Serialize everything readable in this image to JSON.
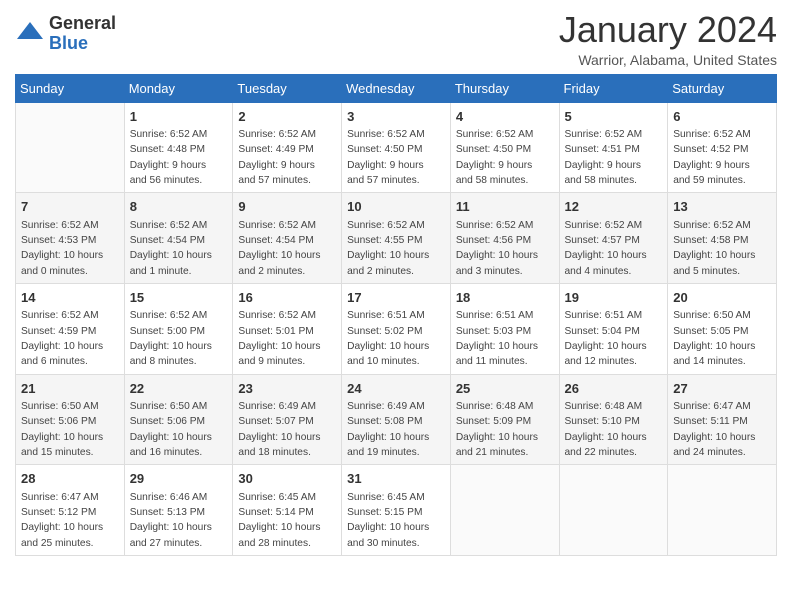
{
  "logo": {
    "general": "General",
    "blue": "Blue"
  },
  "title": "January 2024",
  "location": "Warrior, Alabama, United States",
  "days_of_week": [
    "Sunday",
    "Monday",
    "Tuesday",
    "Wednesday",
    "Thursday",
    "Friday",
    "Saturday"
  ],
  "weeks": [
    [
      {
        "day": "",
        "info": ""
      },
      {
        "day": "1",
        "info": "Sunrise: 6:52 AM\nSunset: 4:48 PM\nDaylight: 9 hours\nand 56 minutes."
      },
      {
        "day": "2",
        "info": "Sunrise: 6:52 AM\nSunset: 4:49 PM\nDaylight: 9 hours\nand 57 minutes."
      },
      {
        "day": "3",
        "info": "Sunrise: 6:52 AM\nSunset: 4:50 PM\nDaylight: 9 hours\nand 57 minutes."
      },
      {
        "day": "4",
        "info": "Sunrise: 6:52 AM\nSunset: 4:50 PM\nDaylight: 9 hours\nand 58 minutes."
      },
      {
        "day": "5",
        "info": "Sunrise: 6:52 AM\nSunset: 4:51 PM\nDaylight: 9 hours\nand 58 minutes."
      },
      {
        "day": "6",
        "info": "Sunrise: 6:52 AM\nSunset: 4:52 PM\nDaylight: 9 hours\nand 59 minutes."
      }
    ],
    [
      {
        "day": "7",
        "info": "Sunrise: 6:52 AM\nSunset: 4:53 PM\nDaylight: 10 hours\nand 0 minutes."
      },
      {
        "day": "8",
        "info": "Sunrise: 6:52 AM\nSunset: 4:54 PM\nDaylight: 10 hours\nand 1 minute."
      },
      {
        "day": "9",
        "info": "Sunrise: 6:52 AM\nSunset: 4:54 PM\nDaylight: 10 hours\nand 2 minutes."
      },
      {
        "day": "10",
        "info": "Sunrise: 6:52 AM\nSunset: 4:55 PM\nDaylight: 10 hours\nand 2 minutes."
      },
      {
        "day": "11",
        "info": "Sunrise: 6:52 AM\nSunset: 4:56 PM\nDaylight: 10 hours\nand 3 minutes."
      },
      {
        "day": "12",
        "info": "Sunrise: 6:52 AM\nSunset: 4:57 PM\nDaylight: 10 hours\nand 4 minutes."
      },
      {
        "day": "13",
        "info": "Sunrise: 6:52 AM\nSunset: 4:58 PM\nDaylight: 10 hours\nand 5 minutes."
      }
    ],
    [
      {
        "day": "14",
        "info": "Sunrise: 6:52 AM\nSunset: 4:59 PM\nDaylight: 10 hours\nand 6 minutes."
      },
      {
        "day": "15",
        "info": "Sunrise: 6:52 AM\nSunset: 5:00 PM\nDaylight: 10 hours\nand 8 minutes."
      },
      {
        "day": "16",
        "info": "Sunrise: 6:52 AM\nSunset: 5:01 PM\nDaylight: 10 hours\nand 9 minutes."
      },
      {
        "day": "17",
        "info": "Sunrise: 6:51 AM\nSunset: 5:02 PM\nDaylight: 10 hours\nand 10 minutes."
      },
      {
        "day": "18",
        "info": "Sunrise: 6:51 AM\nSunset: 5:03 PM\nDaylight: 10 hours\nand 11 minutes."
      },
      {
        "day": "19",
        "info": "Sunrise: 6:51 AM\nSunset: 5:04 PM\nDaylight: 10 hours\nand 12 minutes."
      },
      {
        "day": "20",
        "info": "Sunrise: 6:50 AM\nSunset: 5:05 PM\nDaylight: 10 hours\nand 14 minutes."
      }
    ],
    [
      {
        "day": "21",
        "info": "Sunrise: 6:50 AM\nSunset: 5:06 PM\nDaylight: 10 hours\nand 15 minutes."
      },
      {
        "day": "22",
        "info": "Sunrise: 6:50 AM\nSunset: 5:06 PM\nDaylight: 10 hours\nand 16 minutes."
      },
      {
        "day": "23",
        "info": "Sunrise: 6:49 AM\nSunset: 5:07 PM\nDaylight: 10 hours\nand 18 minutes."
      },
      {
        "day": "24",
        "info": "Sunrise: 6:49 AM\nSunset: 5:08 PM\nDaylight: 10 hours\nand 19 minutes."
      },
      {
        "day": "25",
        "info": "Sunrise: 6:48 AM\nSunset: 5:09 PM\nDaylight: 10 hours\nand 21 minutes."
      },
      {
        "day": "26",
        "info": "Sunrise: 6:48 AM\nSunset: 5:10 PM\nDaylight: 10 hours\nand 22 minutes."
      },
      {
        "day": "27",
        "info": "Sunrise: 6:47 AM\nSunset: 5:11 PM\nDaylight: 10 hours\nand 24 minutes."
      }
    ],
    [
      {
        "day": "28",
        "info": "Sunrise: 6:47 AM\nSunset: 5:12 PM\nDaylight: 10 hours\nand 25 minutes."
      },
      {
        "day": "29",
        "info": "Sunrise: 6:46 AM\nSunset: 5:13 PM\nDaylight: 10 hours\nand 27 minutes."
      },
      {
        "day": "30",
        "info": "Sunrise: 6:45 AM\nSunset: 5:14 PM\nDaylight: 10 hours\nand 28 minutes."
      },
      {
        "day": "31",
        "info": "Sunrise: 6:45 AM\nSunset: 5:15 PM\nDaylight: 10 hours\nand 30 minutes."
      },
      {
        "day": "",
        "info": ""
      },
      {
        "day": "",
        "info": ""
      },
      {
        "day": "",
        "info": ""
      }
    ]
  ]
}
